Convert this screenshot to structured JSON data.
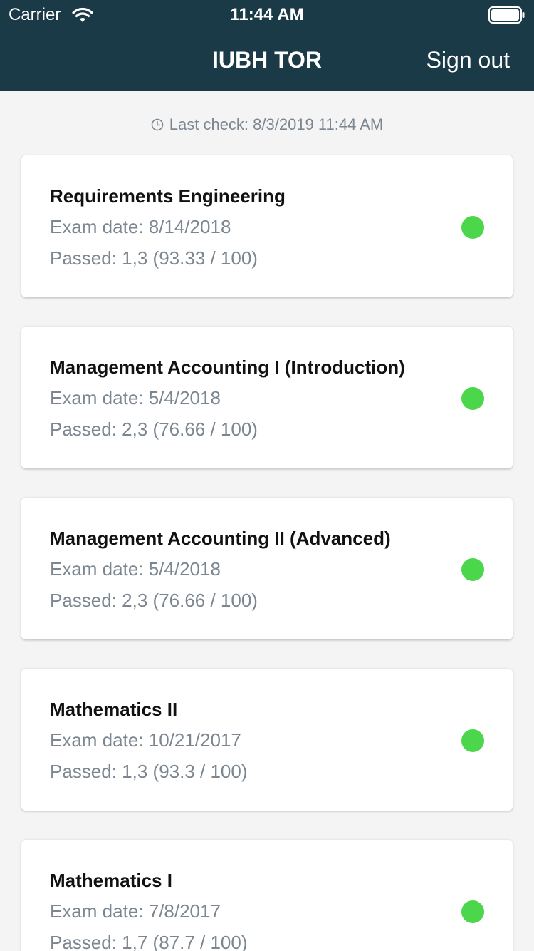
{
  "status_bar": {
    "carrier": "Carrier",
    "time": "11:44 AM",
    "wifi_icon": "wifi-icon",
    "battery_icon": "battery-icon"
  },
  "nav": {
    "title": "IUBH TOR",
    "sign_out_label": "Sign out"
  },
  "last_check": {
    "icon": "clock-icon",
    "text": "Last check: 8/3/2019 11:44 AM"
  },
  "colors": {
    "header_bg": "#1b3a47",
    "passed_dot": "#4cd64c",
    "secondary_text": "#7b8690"
  },
  "exams": [
    {
      "title": "Requirements Engineering",
      "date": "Exam date: 8/14/2018",
      "result": "Passed: 1,3 (93.33 / 100)",
      "status": "passed"
    },
    {
      "title": "Management Accounting I (Introduction)",
      "date": "Exam date: 5/4/2018",
      "result": "Passed: 2,3 (76.66 / 100)",
      "status": "passed"
    },
    {
      "title": "Management Accounting II (Advanced)",
      "date": "Exam date: 5/4/2018",
      "result": "Passed: 2,3 (76.66 / 100)",
      "status": "passed"
    },
    {
      "title": "Mathematics II",
      "date": "Exam date: 10/21/2017",
      "result": "Passed: 1,3 (93.3 / 100)",
      "status": "passed"
    },
    {
      "title": "Mathematics I",
      "date": "Exam date: 7/8/2017",
      "result": "Passed: 1,7 (87.7 / 100)",
      "status": "passed"
    }
  ]
}
